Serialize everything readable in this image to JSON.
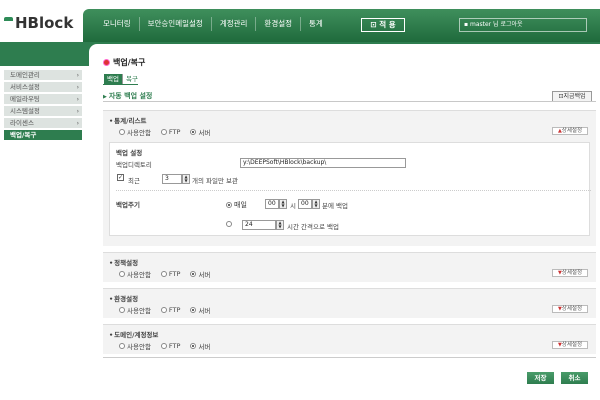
{
  "app": {
    "logo": "HBlock"
  },
  "nav": {
    "items": [
      "모니터링",
      "보안승인메일설정",
      "계정관리",
      "환경설정",
      "통계"
    ],
    "apply_label": "적 용",
    "user_text": "master 님  로그아웃"
  },
  "sidebar": {
    "items": [
      {
        "label": "도메인관리"
      },
      {
        "label": "서비스설정"
      },
      {
        "label": "메일라우팅"
      },
      {
        "label": "시스템설정"
      },
      {
        "label": "라이센스"
      },
      {
        "label": "백업/복구"
      }
    ],
    "active_index": 5
  },
  "page": {
    "title": "백업/복구",
    "tabs": [
      "백업",
      "복구"
    ],
    "section_title": "자동 백업 설정",
    "save_now_label": "지금백업"
  },
  "groups": {
    "stats": {
      "title": "통계/리스트",
      "options": [
        "사용안함",
        "FTP",
        "서버"
      ],
      "selected": 2,
      "detail_label": "상세설정"
    },
    "backup_settings": {
      "title": "백업 설정",
      "dir_label": "백업디렉토리",
      "dir_value": "y:\\DEEPSoft\\HBlock\\backup\\",
      "keep_checked": true,
      "keep_prefix": "최근",
      "keep_value": "3",
      "keep_suffix": "개의 파일만 보관"
    },
    "schedule": {
      "title": "백업주기",
      "daily_label": "매일",
      "hour_value": "00",
      "hour_unit": "시",
      "minute_value": "00",
      "minute_suffix": "분에 백업",
      "interval_value": "24",
      "interval_suffix": "시간 간격으로 백업",
      "selected": 0
    },
    "policy": {
      "title": "정책설정",
      "options": [
        "사용안함",
        "FTP",
        "서버"
      ],
      "selected": 2,
      "detail_label": "상세설정"
    },
    "env": {
      "title": "환경설정",
      "options": [
        "사용안함",
        "FTP",
        "서버"
      ],
      "selected": 2,
      "detail_label": "상세설정"
    },
    "domain": {
      "title": "도메인/계정정보",
      "options": [
        "사용안함",
        "FTP",
        "서버"
      ],
      "selected": 2,
      "detail_label": "상세설정"
    }
  },
  "footer": {
    "save_label": "저장",
    "cancel_label": "취소"
  },
  "colors": {
    "brand_green": "#2e7d4f",
    "accent_red": "#d33333"
  }
}
